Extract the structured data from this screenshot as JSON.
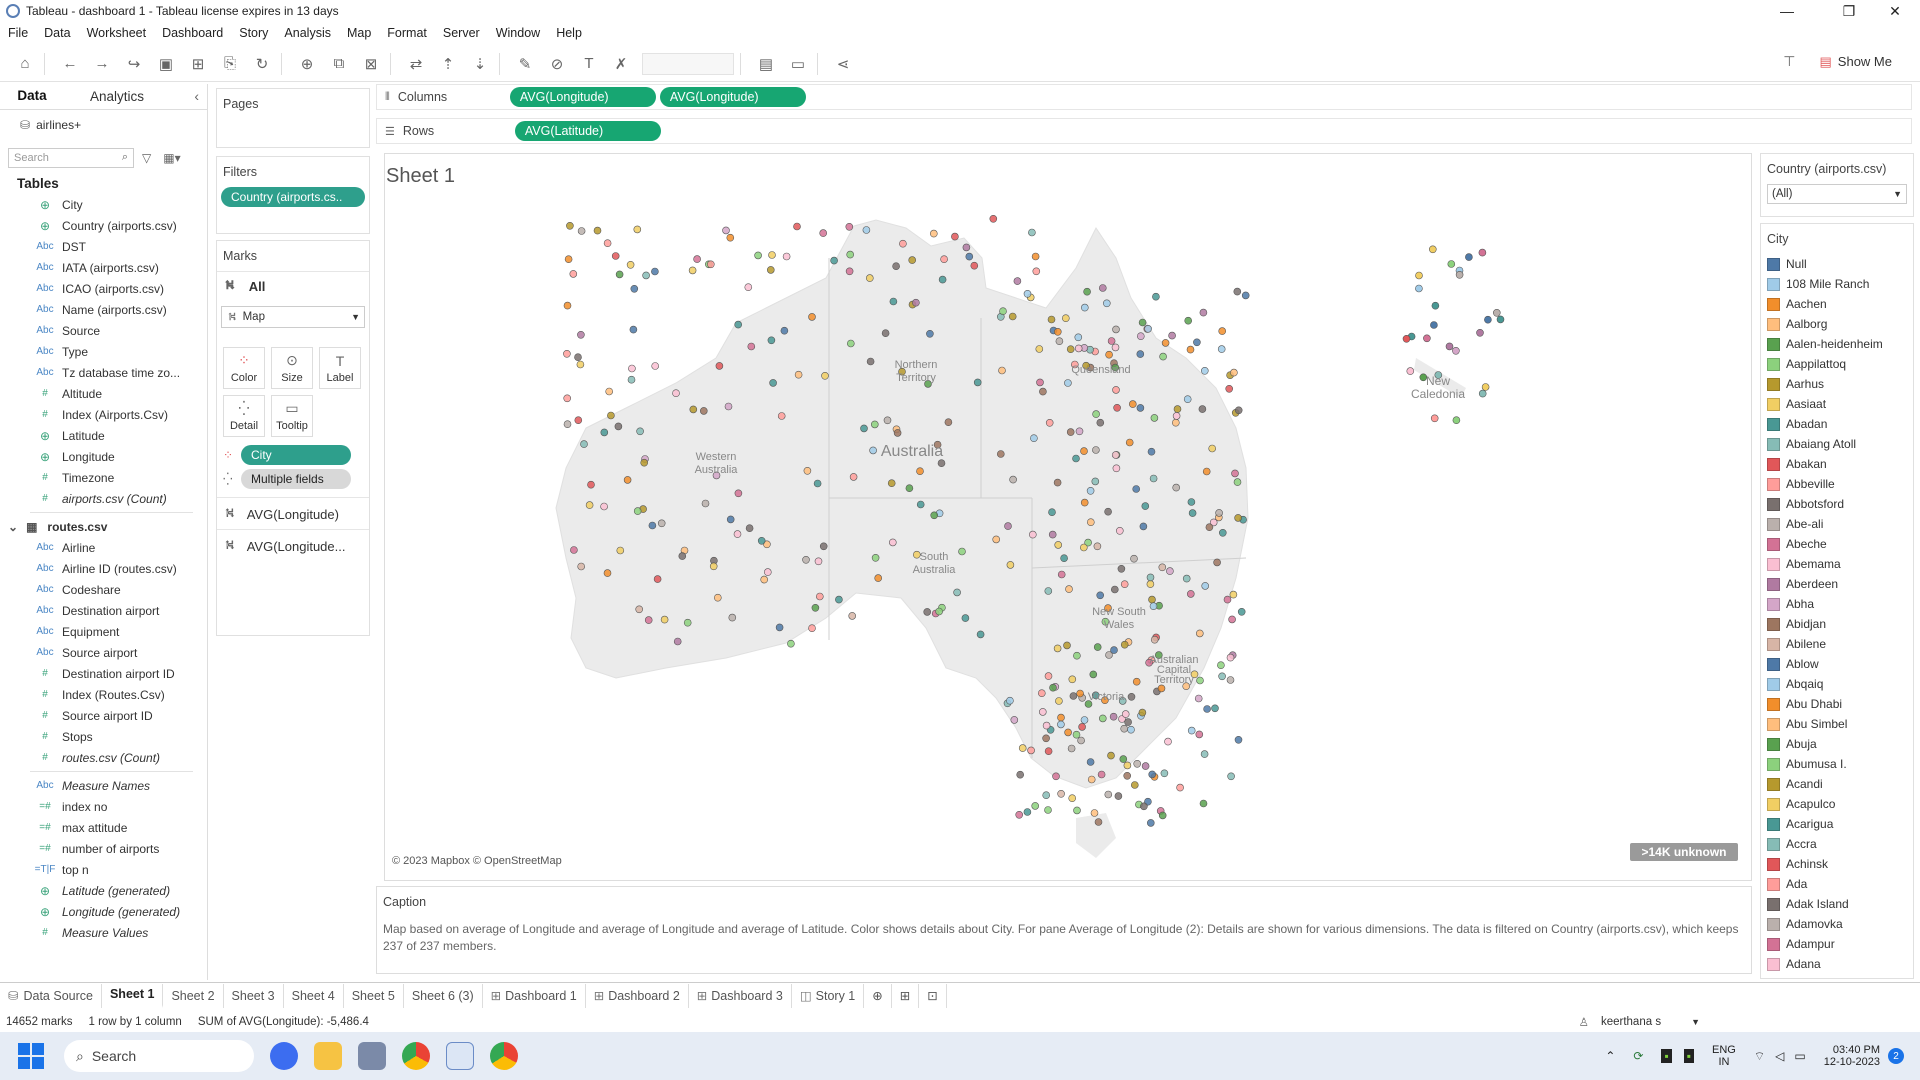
{
  "window": {
    "title": "Tableau - dashboard 1 - Tableau license expires in 13 days",
    "minimize": "—",
    "maximize": "❐",
    "close": "✕"
  },
  "menu": [
    "File",
    "Data",
    "Worksheet",
    "Dashboard",
    "Story",
    "Analysis",
    "Map",
    "Format",
    "Server",
    "Window",
    "Help"
  ],
  "toolbar": {
    "show_me": "Show Me"
  },
  "left": {
    "tab_data": "Data",
    "tab_analytics": "Analytics",
    "datasource": "airlines+",
    "search_placeholder": "Search",
    "tables_header": "Tables",
    "airports_fields": [
      {
        "icon": "geo",
        "label": "City"
      },
      {
        "icon": "geo",
        "label": "Country (airports.csv)"
      },
      {
        "icon": "abc",
        "label": "DST"
      },
      {
        "icon": "abc",
        "label": "IATA (airports.csv)"
      },
      {
        "icon": "abc",
        "label": "ICAO (airports.csv)"
      },
      {
        "icon": "abc",
        "label": "Name (airports.csv)"
      },
      {
        "icon": "abc",
        "label": "Source"
      },
      {
        "icon": "abc",
        "label": "Type"
      },
      {
        "icon": "abc",
        "label": "Tz database time zo..."
      },
      {
        "icon": "num",
        "label": "Altitude"
      },
      {
        "icon": "num",
        "label": "Index (Airports.Csv)"
      },
      {
        "icon": "geo",
        "label": "Latitude"
      },
      {
        "icon": "geo",
        "label": "Longitude"
      },
      {
        "icon": "num",
        "label": "Timezone"
      },
      {
        "icon": "num",
        "label": "airports.csv (Count)",
        "italic": true
      }
    ],
    "routes_table": "routes.csv",
    "routes_fields": [
      {
        "icon": "abc",
        "label": "Airline"
      },
      {
        "icon": "abc",
        "label": "Airline ID (routes.csv)"
      },
      {
        "icon": "abc",
        "label": "Codeshare"
      },
      {
        "icon": "abc",
        "label": "Destination airport"
      },
      {
        "icon": "abc",
        "label": "Equipment"
      },
      {
        "icon": "abc",
        "label": "Source airport"
      },
      {
        "icon": "num",
        "label": "Destination airport ID"
      },
      {
        "icon": "num",
        "label": "Index (Routes.Csv)"
      },
      {
        "icon": "num",
        "label": "Source airport ID"
      },
      {
        "icon": "num",
        "label": "Stops"
      },
      {
        "icon": "num",
        "label": "routes.csv (Count)",
        "italic": true
      }
    ],
    "extra_fields": [
      {
        "icon": "abc",
        "label": "Measure Names",
        "italic": true
      },
      {
        "icon": "calc",
        "label": "index no"
      },
      {
        "icon": "calc",
        "label": "max attitude"
      },
      {
        "icon": "calc",
        "label": "number of airports"
      },
      {
        "icon": "param",
        "label": "top n"
      },
      {
        "icon": "geo",
        "label": "Latitude (generated)",
        "italic": true
      },
      {
        "icon": "geo",
        "label": "Longitude (generated)",
        "italic": true
      },
      {
        "icon": "num",
        "label": "Measure Values",
        "italic": true
      }
    ]
  },
  "pages": {
    "title": "Pages"
  },
  "filters": {
    "title": "Filters",
    "pill": "Country (airports.cs.."
  },
  "marks": {
    "title": "Marks",
    "all": "All",
    "type": "Map",
    "btn_color": "Color",
    "btn_size": "Size",
    "btn_label": "Label",
    "btn_detail": "Detail",
    "btn_tooltip": "Tooltip",
    "pill_city": "City",
    "pill_multiple": "Multiple fields",
    "layer1": "AVG(Longitude)",
    "layer2": "AVG(Longitude..."
  },
  "shelves": {
    "columns_label": "Columns",
    "rows_label": "Rows",
    "col1": "AVG(Longitude)",
    "col2": "AVG(Longitude)",
    "row1": "AVG(Latitude)"
  },
  "sheet": {
    "title": "Sheet 1",
    "attribution": "© 2023 Mapbox © OpenStreetMap",
    "unknown": ">14K unknown",
    "labels": {
      "au": "Australia",
      "wa1": "Western",
      "wa2": "Australia",
      "nt1": "Northern",
      "nt2": "Territory",
      "qld": "Queensland",
      "sa1": "South",
      "sa2": "Australia",
      "nsw1": "New South",
      "nsw2": "Wales",
      "act1": "Australian",
      "act2": "Capital",
      "act3": "Territory",
      "vic": "Victoria",
      "nc1": "New",
      "nc2": "Caledonia"
    }
  },
  "caption": {
    "title": "Caption",
    "text": "Map based on average of Longitude and average of Longitude and average of Latitude.  Color shows details about City.  For pane Average of Longitude (2):  Details are shown for various dimensions. The data is filtered on Country (airports.csv), which keeps 237 of 237 members."
  },
  "legend": {
    "filter_title": "Country (airports.csv)",
    "filter_value": "(All)",
    "city_title": "City",
    "items": [
      {
        "label": "Null",
        "color": "#4e79a7"
      },
      {
        "label": "108 Mile Ranch",
        "color": "#a0cbe8"
      },
      {
        "label": "Aachen",
        "color": "#f28e2b"
      },
      {
        "label": "Aalborg",
        "color": "#ffbe7d"
      },
      {
        "label": "Aalen-heidenheim",
        "color": "#59a14f"
      },
      {
        "label": "Aappilattoq",
        "color": "#8cd17d"
      },
      {
        "label": "Aarhus",
        "color": "#b6992d"
      },
      {
        "label": "Aasiaat",
        "color": "#f1ce63"
      },
      {
        "label": "Abadan",
        "color": "#499894"
      },
      {
        "label": "Abaiang Atoll",
        "color": "#86bcb6"
      },
      {
        "label": "Abakan",
        "color": "#e15759"
      },
      {
        "label": "Abbeville",
        "color": "#ff9d9a"
      },
      {
        "label": "Abbotsford",
        "color": "#79706e"
      },
      {
        "label": "Abe-ali",
        "color": "#bab0ac"
      },
      {
        "label": "Abeche",
        "color": "#d37295"
      },
      {
        "label": "Abemama",
        "color": "#fabfd2"
      },
      {
        "label": "Aberdeen",
        "color": "#b07aa1"
      },
      {
        "label": "Abha",
        "color": "#d4a6c8"
      },
      {
        "label": "Abidjan",
        "color": "#9d7660"
      },
      {
        "label": "Abilene",
        "color": "#d7b5a6"
      },
      {
        "label": "Ablow",
        "color": "#4e79a7"
      },
      {
        "label": "Abqaiq",
        "color": "#a0cbe8"
      },
      {
        "label": "Abu Dhabi",
        "color": "#f28e2b"
      },
      {
        "label": "Abu Simbel",
        "color": "#ffbe7d"
      },
      {
        "label": "Abuja",
        "color": "#59a14f"
      },
      {
        "label": "Abumusa I.",
        "color": "#8cd17d"
      },
      {
        "label": "Acandi",
        "color": "#b6992d"
      },
      {
        "label": "Acapulco",
        "color": "#f1ce63"
      },
      {
        "label": "Acarigua",
        "color": "#499894"
      },
      {
        "label": "Accra",
        "color": "#86bcb6"
      },
      {
        "label": "Achinsk",
        "color": "#e15759"
      },
      {
        "label": "Ada",
        "color": "#ff9d9a"
      },
      {
        "label": "Adak Island",
        "color": "#79706e"
      },
      {
        "label": "Adamovka",
        "color": "#bab0ac"
      },
      {
        "label": "Adampur",
        "color": "#d37295"
      },
      {
        "label": "Adana",
        "color": "#fabfd2"
      }
    ]
  },
  "sheet_tabs": [
    "Data Source",
    "Sheet 1",
    "Sheet 2",
    "Sheet 3",
    "Sheet 4",
    "Sheet 5",
    "Sheet 6 (3)",
    "Dashboard 1",
    "Dashboard 2",
    "Dashboard 3",
    "Story 1"
  ],
  "status": {
    "marks": "14652 marks",
    "rows": "1 row by 1 column",
    "sum": "SUM of AVG(Longitude): -5,486.4",
    "user": "keerthana s"
  },
  "taskbar": {
    "search": "Search",
    "lang1": "ENG",
    "lang2": "IN",
    "time": "03:40 PM",
    "date": "12-10-2023",
    "badge": "2"
  }
}
